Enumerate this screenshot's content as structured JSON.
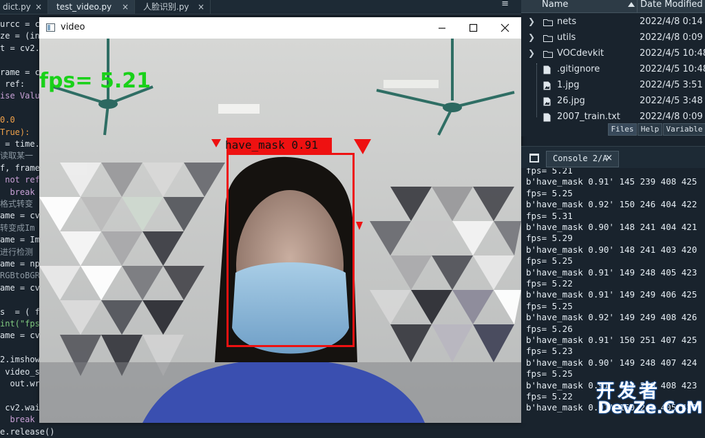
{
  "editor": {
    "tabs": [
      {
        "label": "dict.py",
        "active": false
      },
      {
        "label": "test_video.py",
        "active": true
      },
      {
        "label": "人脸识别.py",
        "active": false
      }
    ],
    "close_glyph": "×",
    "menu_glyph": "≡",
    "code_lines": [
      {
        "text": "urcc = c",
        "color": "#dfe6ec"
      },
      {
        "text": "ze = (in",
        "color": "#dfe6ec"
      },
      {
        "text": "t = cv2.",
        "color": "#dfe6ec"
      },
      {
        "text": "",
        "color": "#dfe6ec"
      },
      {
        "text": "rame = c",
        "color": "#dfe6ec"
      },
      {
        "text": " ref:",
        "color": "#dfe6ec"
      },
      {
        "text": "ise Valu",
        "color": "#c8a0d6"
      },
      {
        "text": "",
        "color": "#dfe6ec"
      },
      {
        "text": "0.0",
        "color": "#f0a14a"
      },
      {
        "text": "True):",
        "color": "#f0a14a"
      },
      {
        "text": " = time.",
        "color": "#dfe6ec"
      },
      {
        "text": "读取某一",
        "color": "#8c98a2"
      },
      {
        "text": "f, frame",
        "color": "#dfe6ec"
      },
      {
        "text": " not ref",
        "color": "#c8a0d6"
      },
      {
        "text": "  break",
        "color": "#c8a0d6"
      },
      {
        "text": "格式转变",
        "color": "#8c98a2"
      },
      {
        "text": "ame = cv",
        "color": "#dfe6ec"
      },
      {
        "text": "转变成Im",
        "color": "#8c98a2"
      },
      {
        "text": "ame = Im",
        "color": "#dfe6ec"
      },
      {
        "text": "进行检测",
        "color": "#8c98a2"
      },
      {
        "text": "ame = np",
        "color": "#dfe6ec"
      },
      {
        "text": "RGBtoBGR",
        "color": "#8c98a2"
      },
      {
        "text": "ame = cv",
        "color": "#dfe6ec"
      },
      {
        "text": "",
        "color": "#dfe6ec"
      },
      {
        "text": "s  = ( f",
        "color": "#dfe6ec"
      },
      {
        "text": "int(\"fps",
        "color": "#7fc97f"
      },
      {
        "text": "ame = cv",
        "color": "#dfe6ec"
      },
      {
        "text": "",
        "color": "#dfe6ec"
      },
      {
        "text": "2.imshow",
        "color": "#dfe6ec"
      },
      {
        "text": " video_s",
        "color": "#dfe6ec"
      },
      {
        "text": "  out.wr",
        "color": "#dfe6ec"
      },
      {
        "text": "",
        "color": "#dfe6ec"
      },
      {
        "text": " cv2.wai",
        "color": "#dfe6ec"
      },
      {
        "text": "  break",
        "color": "#c8a0d6"
      },
      {
        "text": "e.release()",
        "color": "#dfe6ec"
      }
    ]
  },
  "video_window": {
    "title": "video",
    "fps_overlay": "fps= 5.21",
    "detection_label": "have_mask 0.91",
    "box_color": "#ee1111",
    "fps_color": "#19d119"
  },
  "files": {
    "columns": {
      "name": "Name",
      "date": "Date Modified"
    },
    "rows": [
      {
        "name": "nets",
        "date": "2022/4/8 0:14",
        "type": "folder"
      },
      {
        "name": "utils",
        "date": "2022/4/8 0:09",
        "type": "folder"
      },
      {
        "name": "VOCdevkit",
        "date": "2022/4/5 10:48",
        "type": "folder"
      },
      {
        "name": ".gitignore",
        "date": "2022/4/5 10:48",
        "type": "file"
      },
      {
        "name": "1.jpg",
        "date": "2022/4/5 3:51",
        "type": "image"
      },
      {
        "name": "26.jpg",
        "date": "2022/4/5 3:48",
        "type": "image"
      },
      {
        "name": "2007_train.txt",
        "date": "2022/4/8 0:09",
        "type": "file"
      }
    ],
    "pane_tabs": [
      "Files",
      "Help",
      "Variable"
    ]
  },
  "console": {
    "tab_label": "Console 2/A",
    "lines": [
      "fps= 5.21",
      "b'have_mask 0.91' 145 239 408 425",
      "fps= 5.25",
      "b'have_mask 0.92' 150 246 404 422",
      "fps= 5.31",
      "b'have_mask 0.90' 148 241 404 421",
      "fps= 5.29",
      "b'have_mask 0.90' 148 241 403 420",
      "fps= 5.25",
      "b'have_mask 0.91' 149 248 405 423",
      "fps= 5.22",
      "b'have_mask 0.91' 149 249 406 425",
      "fps= 5.25",
      "b'have_mask 0.92' 149 249 408 426",
      "fps= 5.26",
      "b'have_mask 0.91' 150 251 407 425",
      "fps= 5.23",
      "b'have_mask 0.90' 149 248 407 424",
      "fps= 5.25",
      "b'have_mask 0.91' 149 249 408 423",
      "fps= 5.22",
      "b'have_mask 0.91' 150 249 405 423"
    ]
  },
  "watermark": {
    "cn": "开发者",
    "en": "DevZe.CoM"
  }
}
